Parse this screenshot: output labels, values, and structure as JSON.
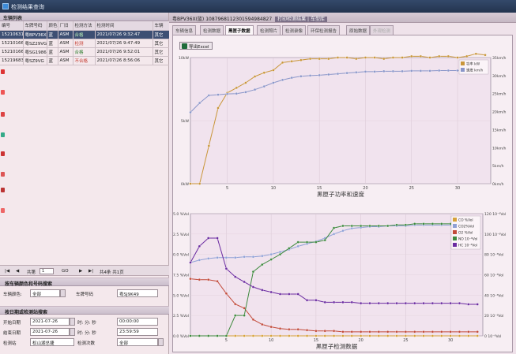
{
  "window": {
    "title": "检测结果查询"
  },
  "left": {
    "list_header": "车辆列表",
    "columns": [
      "编号",
      "车牌号码",
      "颜色",
      "厂旧",
      "检测方法",
      "检测时间",
      "车辆"
    ],
    "rows": [
      {
        "id": "15210631",
        "plate": "粤BPV36X",
        "color": "蓝",
        "type": "ASM",
        "result": "合格",
        "time": "2021/07/26 9:32:47",
        "extra": "其它",
        "status": "ok",
        "selected": true
      },
      {
        "id": "15210166",
        "plate": "粤SZ29VG",
        "color": "蓝",
        "type": "ASM",
        "result": "检测",
        "time": "2021/07/26 9:47:49",
        "extra": "其它",
        "status": "warn",
        "selected": false
      },
      {
        "id": "15210166",
        "plate": "粤SG1986",
        "color": "蓝",
        "type": "ASM",
        "result": "合格",
        "time": "2021/07/26 9:52:01",
        "extra": "其它",
        "status": "ok",
        "selected": false
      },
      {
        "id": "15219683",
        "plate": "粤SZ9VG",
        "color": "蓝",
        "type": "ASM",
        "result": "不合格",
        "time": "2021/07/26 8:56:06",
        "extra": "其它",
        "status": "warn",
        "selected": false
      }
    ],
    "pager": {
      "page_label": "共1页",
      "current": "1",
      "go": "GO",
      "total": "共4条 共1页"
    },
    "section1": "按车辆颜色和号码搜索",
    "color_label": "车辆颜色:",
    "color_value": "全部",
    "plate_label": "车牌号码",
    "plate_value": "粤SJ9K49",
    "section2": "按日期或检测站搜索",
    "start_label": "开始日期",
    "start_date": "2021-07-26",
    "start_hm_label": "时: 分: 秒",
    "start_time": "00:00:00",
    "end_label": "结束日期",
    "end_date": "2021-07-26",
    "end_hm_label": "时: 分: 秒",
    "end_time": "23:59:59",
    "station_label": "检测站",
    "station_value": "松山湖总捷",
    "count_label": "检测次数",
    "count_value": "全部"
  },
  "right": {
    "title_prefix": "粤BPV36X(蓝)",
    "title_code": "1087968112301594984827",
    "title_highlight": "打印检测结果 | 车型库",
    "tabs": [
      "车辆信息",
      "检测数据",
      "黑匣子数据",
      "检测照片",
      "检测录像",
      "环保检测报告",
      "原始数据",
      "外观检测"
    ],
    "active_tab": 2,
    "export_label": "导出Excel"
  },
  "chart_data": [
    {
      "type": "line",
      "title": "黑匣子功率和速度",
      "xlabel": "",
      "ylabel": "",
      "x": [
        1,
        2,
        3,
        4,
        5,
        6,
        7,
        8,
        9,
        10,
        11,
        12,
        13,
        14,
        15,
        16,
        17,
        18,
        19,
        20,
        21,
        22,
        23,
        24,
        25,
        26,
        27,
        28,
        29,
        30,
        31,
        32,
        33
      ],
      "ylim_left": [
        0,
        10
      ],
      "ylim_right": [
        0,
        35
      ],
      "left_ticks": [
        "0kW",
        "5kW",
        "10kW"
      ],
      "right_ticks": [
        "0km/h",
        "5km/h",
        "10km/h",
        "15km/h",
        "20km/h",
        "25km/h",
        "30km/h",
        "35km/h"
      ],
      "x_ticks": [
        5,
        10,
        15,
        20,
        25,
        30
      ],
      "series": [
        {
          "name": "功率 kW",
          "axis": "left",
          "color": "#c9963a",
          "values": [
            0,
            0,
            3,
            6,
            7.2,
            7.6,
            8.0,
            8.5,
            8.8,
            9.0,
            9.6,
            9.7,
            9.8,
            9.9,
            9.9,
            9.9,
            10.0,
            10.0,
            9.9,
            10.0,
            10.0,
            9.9,
            10.0,
            10.0,
            10.1,
            10.1,
            10.0,
            10.1,
            10.1,
            10.0,
            10.1,
            10.3,
            10.2
          ]
        },
        {
          "name": "速度 km/h",
          "axis": "right",
          "color": "#8a96c9",
          "values": [
            19.8,
            22.4,
            24.5,
            24.7,
            24.9,
            25.0,
            25.4,
            26.1,
            27.0,
            28.0,
            28.8,
            29.4,
            29.8,
            30.0,
            30.1,
            30.3,
            30.5,
            30.7,
            30.9,
            31.1,
            31.1,
            31.2,
            31.2,
            31.2,
            31.3,
            31.3,
            31.3,
            31.4,
            31.4,
            31.4,
            31.4,
            31.5,
            31.5
          ]
        }
      ],
      "legend": "top-right",
      "grid": true
    },
    {
      "type": "line",
      "title": "黑匣子检测数据",
      "xlabel": "",
      "ylabel": "",
      "x": [
        1,
        2,
        3,
        4,
        5,
        6,
        7,
        8,
        9,
        10,
        11,
        12,
        13,
        14,
        15,
        16,
        17,
        18,
        19,
        20,
        21,
        22,
        23,
        24,
        25,
        26,
        27,
        28,
        29,
        30,
        31,
        32,
        33
      ],
      "ylim_left": [
        0,
        15
      ],
      "ylim_right": [
        0,
        120
      ],
      "left_ticks": [
        "0.0 %Vol",
        "2.5 %Vol",
        "5.0 %Vol",
        "7.5 %Vol",
        "10.0 %Vol",
        "12.5 %Vol",
        "15.0 %Vol"
      ],
      "right_ticks": [
        "0 10⁻⁶Vol",
        "20 10⁻⁶Vol",
        "40 10⁻⁶Vol",
        "60 10⁻⁶Vol",
        "80 10⁻⁶Vol",
        "100 10⁻⁶Vol",
        "120 10⁻⁶Vol"
      ],
      "x_ticks": [
        5,
        10,
        15,
        20,
        25,
        30
      ],
      "series": [
        {
          "name": "CO %Vol",
          "axis": "left",
          "color": "#d6a23a",
          "values": [
            0,
            0,
            0,
            0,
            0,
            0,
            0,
            0,
            0,
            0,
            0,
            0,
            0,
            0,
            0,
            0,
            0,
            0,
            0,
            0,
            0,
            0,
            0,
            0,
            0,
            0,
            0,
            0,
            0,
            0,
            0,
            0,
            0
          ]
        },
        {
          "name": "CO2%Vol",
          "axis": "left",
          "color": "#8fa0d6",
          "values": [
            9.0,
            9.3,
            9.5,
            9.6,
            9.6,
            9.6,
            9.7,
            9.7,
            9.8,
            10.0,
            10.3,
            10.6,
            11.0,
            11.3,
            11.6,
            12.0,
            12.5,
            12.9,
            13.2,
            13.3,
            13.4,
            13.4,
            13.5,
            13.5,
            13.5,
            13.6,
            13.6,
            13.6,
            13.6,
            13.6,
            13.6,
            13.6,
            13.6
          ]
        },
        {
          "name": "O2 %Vol",
          "axis": "left",
          "color": "#c24a3a",
          "values": [
            7.0,
            6.9,
            6.9,
            6.7,
            5.2,
            3.9,
            3.4,
            2.0,
            1.4,
            1.1,
            0.9,
            0.8,
            0.8,
            0.7,
            0.6,
            0.6,
            0.6,
            0.5,
            0.5,
            0.5,
            0.5,
            0.5,
            0.5,
            0.5,
            0.5,
            0.5,
            0.5,
            0.5,
            0.5,
            0.5,
            0.5,
            0.5,
            0.5
          ]
        },
        {
          "name": "NO 10⁻⁶Vol",
          "axis": "right",
          "color": "#3e8a3e",
          "values": [
            0,
            0,
            0,
            0,
            0,
            20,
            20,
            63,
            70,
            75,
            80,
            86,
            92,
            92,
            92,
            94,
            106,
            108,
            108,
            108,
            108,
            108,
            108,
            109,
            109,
            110,
            110,
            110,
            110,
            110,
            110,
            110,
            110
          ]
        },
        {
          "name": "HC 10⁻⁶Vol",
          "axis": "right",
          "color": "#6a2aa0",
          "values": [
            72,
            88,
            96,
            96,
            66,
            58,
            53,
            48,
            45,
            43,
            41,
            41,
            41,
            35,
            35,
            33,
            33,
            33,
            33,
            32,
            32,
            32,
            32,
            32,
            32,
            32,
            32,
            32,
            32,
            32,
            32,
            31,
            31
          ]
        }
      ],
      "legend": "top-right",
      "grid": true
    }
  ]
}
